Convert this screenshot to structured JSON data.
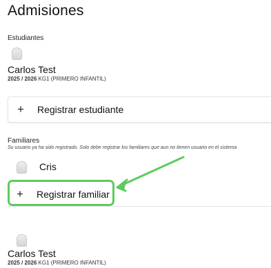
{
  "page": {
    "title": "Admisiones"
  },
  "students": {
    "label": "Estudiantes",
    "item": {
      "name": "Carlos Test",
      "year": "2025 / 2026",
      "grade": "KG1 (PRIMERO INFANTIL)"
    },
    "add_label": "Registrar estudiante",
    "plus": "+"
  },
  "family": {
    "label": "Familiares",
    "note": "Su usuario ya ha sido registrado. Solo debe registrar los familiares que aun no tienen usuario en el sistema",
    "member": "Cris",
    "add_label": "Registrar familiar",
    "plus": "+"
  },
  "student2": {
    "name": "Carlos Test",
    "year": "2025 / 2026",
    "grade": "KG1 (PRIMERO INFANTIL)"
  },
  "colors": {
    "highlight": "#5ccb5c"
  }
}
